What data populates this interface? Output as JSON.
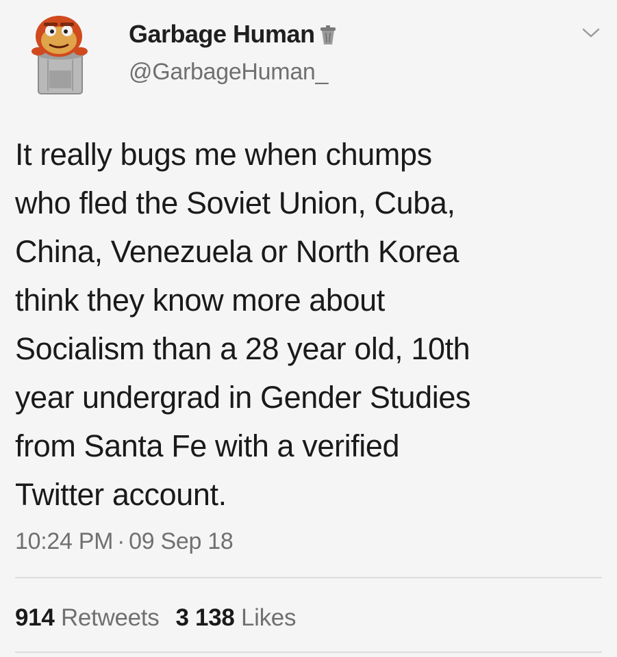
{
  "author": {
    "display_name": "Garbage Human",
    "handle": "@GarbageHuman_",
    "avatar_icon": "trash-can-character-icon",
    "badge_icon": "trash-can-icon",
    "menu_icon": "chevron-down-icon"
  },
  "tweet": {
    "text": "It really bugs me when chumps\nwho fled the Soviet Union, Cuba,\nChina, Venezuela or North Korea\nthink they know more about\nSocialism than a 28 year old, 10th\nyear undergrad in Gender Studies\nfrom Santa Fe with a verified\nTwitter account.",
    "time": "10:24 PM",
    "separator": "·",
    "date": "09 Sep 18"
  },
  "stats": {
    "retweets_count": "914",
    "retweets_label": "Retweets",
    "likes_count": "3 138",
    "likes_label": "Likes"
  },
  "colors": {
    "background": "#f5f5f5",
    "text_primary": "#1a1a1a",
    "text_secondary": "#707070",
    "divider": "#dcdcdc"
  }
}
